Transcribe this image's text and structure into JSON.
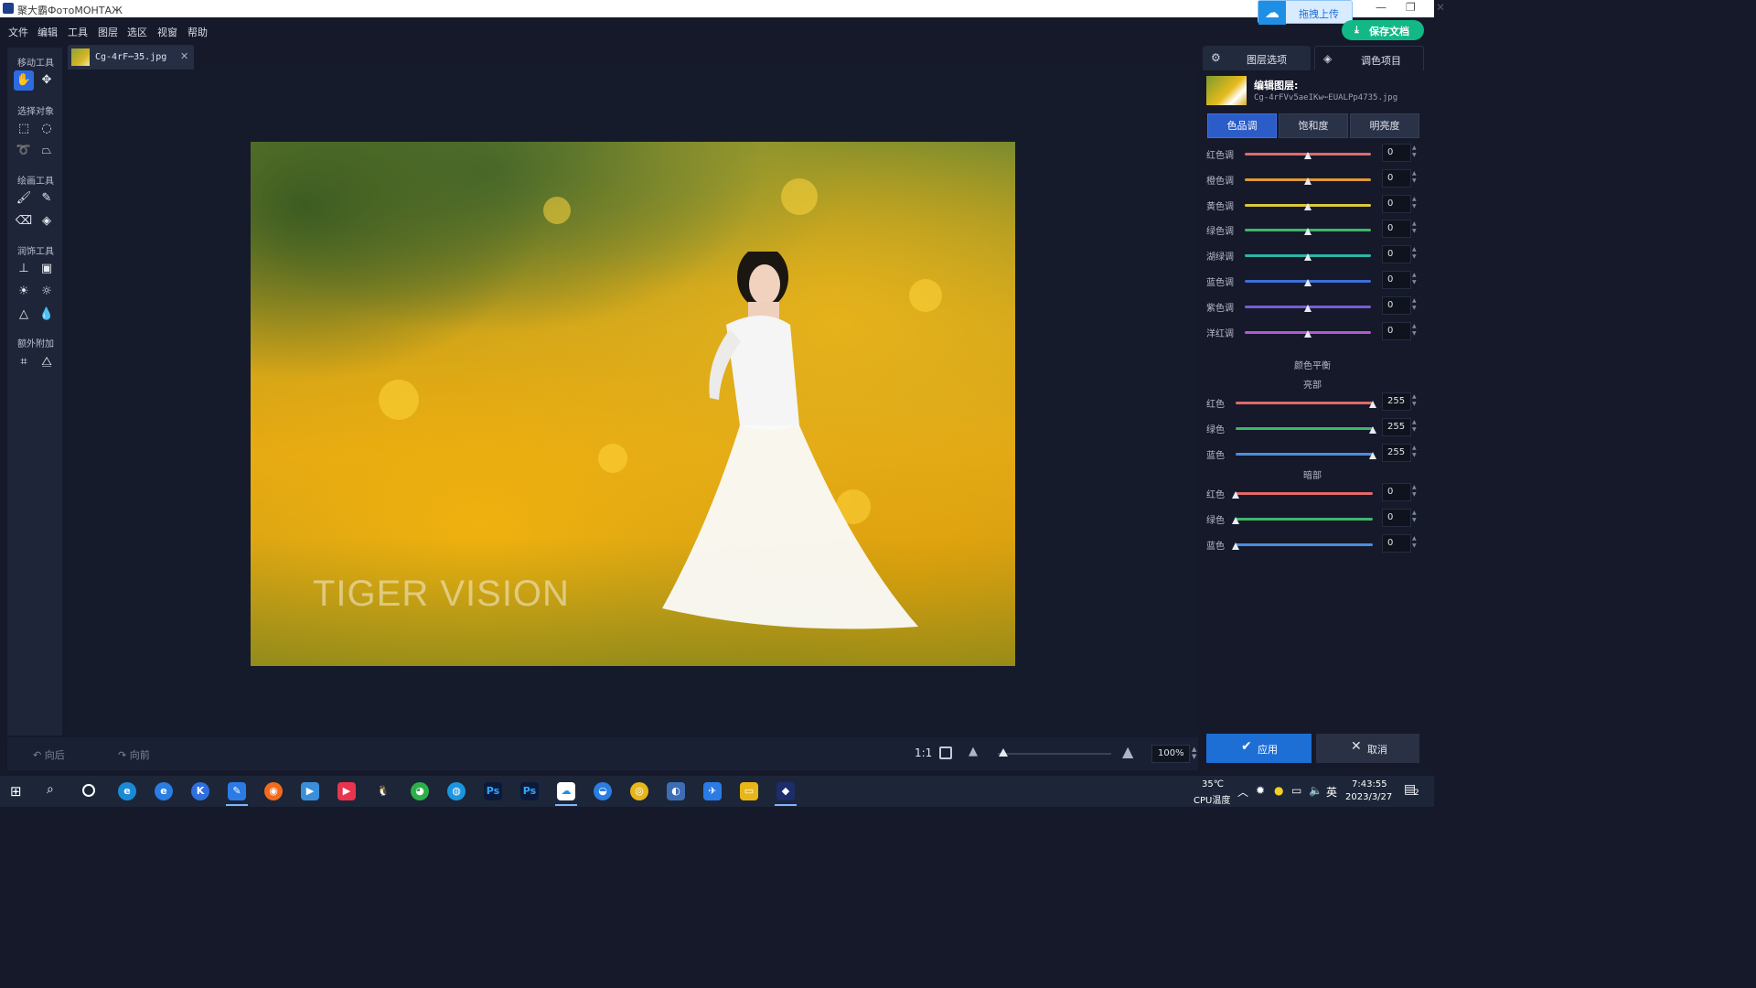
{
  "window": {
    "title": "聚大霸ФотоМОНТАЖ",
    "upload_label": "拖拽上传"
  },
  "menu": {
    "items": [
      "文件",
      "编辑",
      "工具",
      "图层",
      "选区",
      "视窗",
      "帮助"
    ],
    "save_label": "保存文档"
  },
  "toolbar": {
    "groups": {
      "move": "移动工具",
      "select": "选择对象",
      "draw": "绘画工具",
      "retouch": "润饰工具",
      "extra": "额外附加"
    }
  },
  "document_tab": {
    "name": "Cg-4rF⋯35.jpg",
    "close": "✕"
  },
  "photo": {
    "watermark": "TIGER VISION"
  },
  "bottombar": {
    "undo": "向后",
    "redo": "向前",
    "ratio": "1:1",
    "zoom_value": "100%",
    "zoom_fraction": 0.05
  },
  "right_panel": {
    "tabs": [
      "图层选项",
      "调色项目"
    ],
    "layer_title": "编辑图层:",
    "layer_file": "Cg-4rFVv5aeIKw⋯EUALPp4735.jpg",
    "subtabs": [
      "色品调",
      "饱和度",
      "明亮度"
    ],
    "hue_sliders": [
      {
        "label": "红色调",
        "value": "0",
        "color": "#e06a6a"
      },
      {
        "label": "橙色调",
        "value": "0",
        "color": "#e0983a"
      },
      {
        "label": "黄色调",
        "value": "0",
        "color": "#d9c93c"
      },
      {
        "label": "绿色调",
        "value": "0",
        "color": "#3fb66a"
      },
      {
        "label": "湖绿调",
        "value": "0",
        "color": "#2fb5a6"
      },
      {
        "label": "蓝色调",
        "value": "0",
        "color": "#3d6fd8"
      },
      {
        "label": "紫色调",
        "value": "0",
        "color": "#7a5ad8"
      },
      {
        "label": "洋红调",
        "value": "0",
        "color": "#b45ad0"
      }
    ],
    "color_balance_title": "颜色平衡",
    "highlights_label": "亮部",
    "highlights": [
      {
        "label": "红色",
        "value": "255",
        "color": "#e06a6a"
      },
      {
        "label": "绿色",
        "value": "255",
        "color": "#3fb66a"
      },
      {
        "label": "蓝色",
        "value": "255",
        "color": "#4a8fe0"
      }
    ],
    "shadows_label": "暗部",
    "shadows": [
      {
        "label": "红色",
        "value": "0",
        "color": "#e06a6a"
      },
      {
        "label": "绿色",
        "value": "0",
        "color": "#3fb66a"
      },
      {
        "label": "蓝色",
        "value": "0",
        "color": "#4a8fe0"
      }
    ],
    "apply_label": "应用",
    "cancel_label": "取消"
  },
  "taskbar": {
    "weather": "35℃",
    "weather_sub": "CPU温度",
    "ime": "英",
    "time": "7:43:55",
    "date": "2023/3/27",
    "notifications": "2"
  },
  "colors": {
    "accent": "#2d6ce0",
    "save_green": "#12b886",
    "background": "#15192a"
  }
}
